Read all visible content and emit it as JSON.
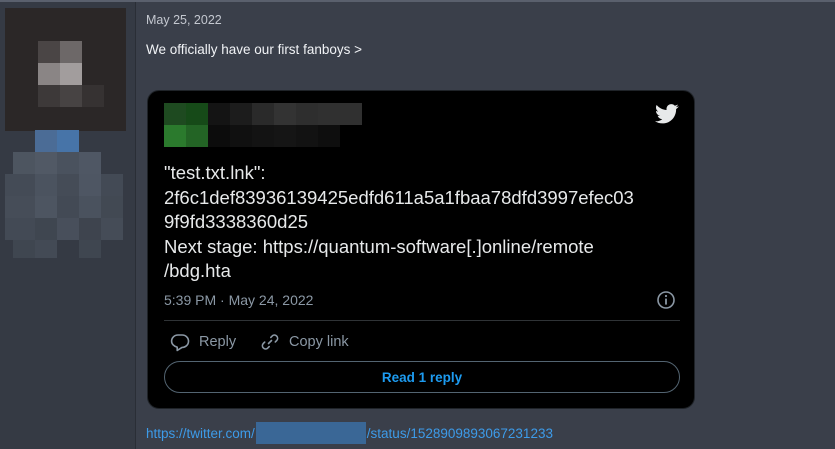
{
  "post": {
    "date": "May 25, 2022",
    "text": "We officially have our first fanboys >"
  },
  "tweet": {
    "body_lines": [
      "\"test.txt.lnk\":",
      "2f6c1def83936139425edfd611a5a1fbaa78dfd3997efec03",
      "9f9fd3338360d25",
      "Next stage: https://quantum-software[.]online/remote",
      "/bdg.hta"
    ],
    "time": "5:39 PM",
    "separator": "·",
    "date": "May 24, 2022",
    "reply_label": "Reply",
    "copy_link_label": "Copy link",
    "read_replies_label": "Read 1 reply"
  },
  "link": {
    "prefix": "https://twitter.com/",
    "suffix": "/status/1528909893067231233"
  },
  "icons": {
    "twitter": "twitter-bird-icon",
    "info": "info-icon",
    "reply": "speech-bubble-icon",
    "copy_link": "chain-link-icon"
  },
  "colors": {
    "page_bg": "#3a3f4a",
    "tweet_bg": "#000000",
    "twitter_blue": "#1d9bf0",
    "link_blue": "#3d9be9"
  }
}
